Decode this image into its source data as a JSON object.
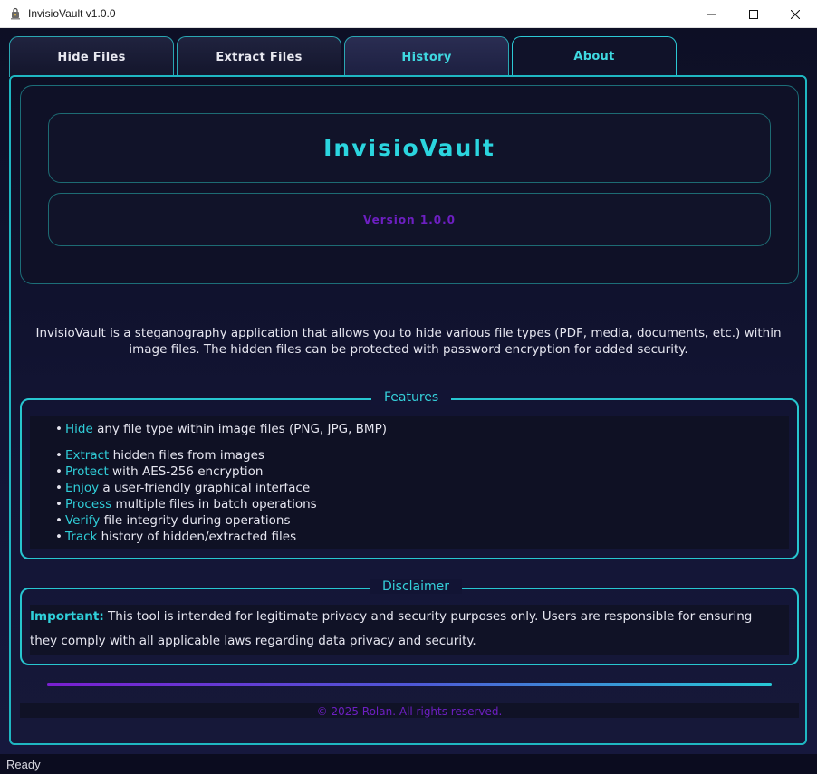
{
  "window": {
    "title": "InvisioVault v1.0.0",
    "app_icon": "app-icon",
    "controls": {
      "minimize_icon": "minimize-icon",
      "maximize_icon": "maximize-icon",
      "close_icon": "close-icon"
    }
  },
  "tabs": [
    {
      "label": "Hide Files",
      "active": false
    },
    {
      "label": "Extract Files",
      "active": false
    },
    {
      "label": "History",
      "active": false
    },
    {
      "label": "About",
      "active": true
    }
  ],
  "about": {
    "title": "InvisioVault",
    "version": "Version 1.0.0",
    "description": "InvisioVault is a steganography application that allows you to hide various file types (PDF, media, documents, etc.) within image files. The hidden files can be protected with password encryption for added security.",
    "features": {
      "title": "Features",
      "items": [
        {
          "keyword": "Hide",
          "rest": " any file type within image files (PNG, JPG, BMP)"
        },
        {
          "keyword": "Extract",
          "rest": " hidden files from images"
        },
        {
          "keyword": "Protect",
          "rest": " with AES-256 encryption"
        },
        {
          "keyword": "Enjoy",
          "rest": " a user-friendly graphical interface"
        },
        {
          "keyword": "Process",
          "rest": " multiple files in batch operations"
        },
        {
          "keyword": "Verify",
          "rest": " file integrity during operations"
        },
        {
          "keyword": "Track",
          "rest": " history of hidden/extracted files"
        }
      ]
    },
    "disclaimer": {
      "title": "Disclaimer",
      "label": "Important:",
      "text": " This tool is intended for legitimate privacy and security purposes only. Users are responsible for ensuring they comply with all applicable laws regarding data privacy and security."
    },
    "footer": "© 2025 Rolan. All rights reserved."
  },
  "status": "Ready",
  "colors": {
    "accent": "#2bd5df",
    "purple": "#6d1fc2",
    "background": "#0e1026",
    "text": "#e6e6f0"
  }
}
